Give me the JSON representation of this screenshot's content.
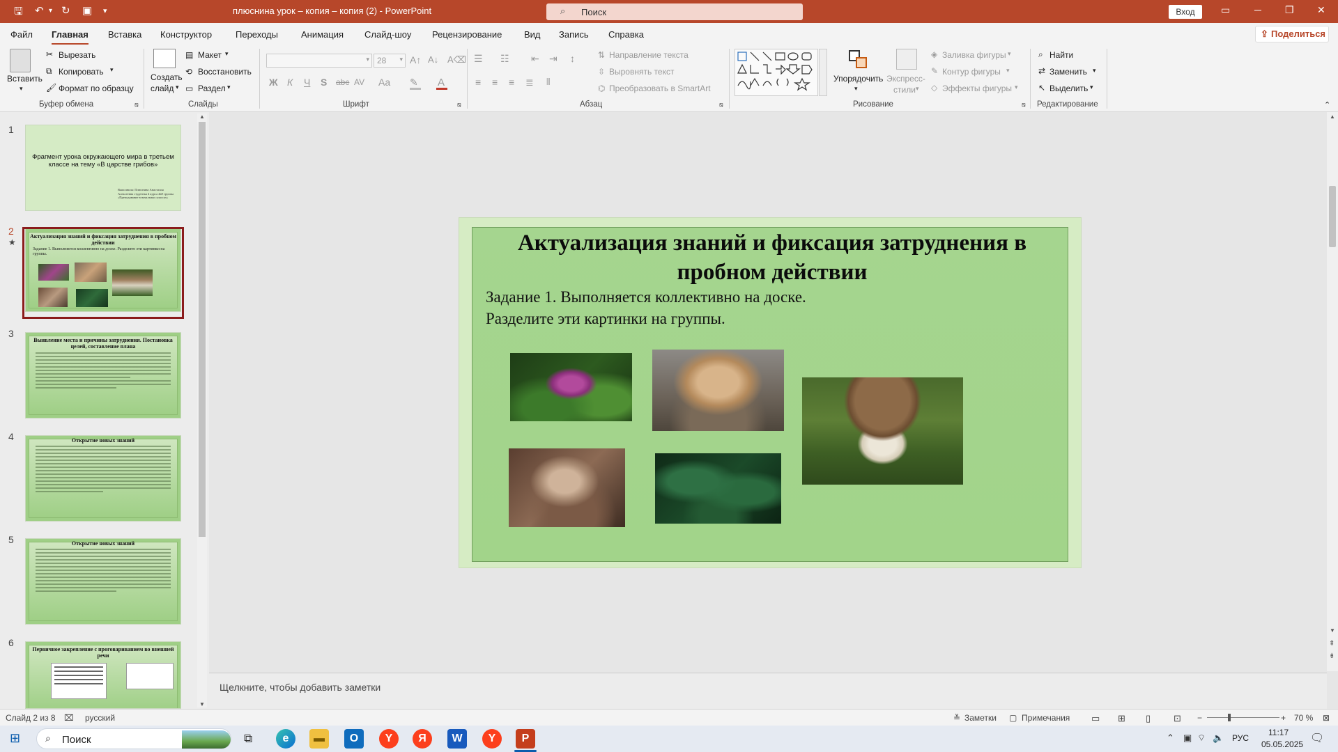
{
  "window": {
    "title": "плюснина урок – копия – копия (2)  -  PowerPoint",
    "search_placeholder": "Поиск",
    "sign_in": "Вход"
  },
  "menu": {
    "tabs": [
      "Файл",
      "Главная",
      "Вставка",
      "Конструктор",
      "Переходы",
      "Анимация",
      "Слайд-шоу",
      "Рецензирование",
      "Вид",
      "Запись",
      "Справка"
    ],
    "active": "Главная",
    "share": "Поделиться"
  },
  "ribbon": {
    "clipboard": {
      "paste": "Вставить",
      "cut": "Вырезать",
      "copy": "Копировать",
      "format_painter": "Формат по образцу",
      "title": "Буфер обмена"
    },
    "slides": {
      "new_slide_1": "Создать",
      "new_slide_2": "слайд",
      "layout": "Макет",
      "reset": "Восстановить",
      "section": "Раздел",
      "title": "Слайды"
    },
    "font": {
      "size": "28",
      "title": "Шрифт",
      "bold": "Ж",
      "italic": "К",
      "underline": "Ч",
      "shadow": "S",
      "strike": "abc",
      "spacing": "AV",
      "case": "Aa"
    },
    "paragraph": {
      "text_direction": "Направление текста",
      "align_text": "Выровнять текст",
      "smartart": "Преобразовать в SmartArt",
      "title": "Абзац"
    },
    "drawing": {
      "arrange": "Упорядочить",
      "quick_styles_1": "Экспресс-",
      "quick_styles_2": "стили",
      "shape_fill": "Заливка фигуры",
      "shape_outline": "Контур фигуры",
      "shape_effects": "Эффекты фигуры",
      "title": "Рисование"
    },
    "editing": {
      "find": "Найти",
      "replace": "Заменить",
      "select": "Выделить",
      "title": "Редактирование"
    }
  },
  "thumbnails": [
    {
      "num": "1",
      "title": "Фрагмент урока окружающего мира в третьем классе на тему «В царстве грибов»",
      "sub": "Выполнила: Плюснина Анастасия Алексеевна студентка 4 курса 4в9 группы «Преподавание в начальных классах»"
    },
    {
      "num": "2",
      "title": "Актуализация знаний и фиксация затруднения в пробном действии",
      "sub": "Задание 1. Выполняется коллективно на доске. Разделите эти картинки на группы."
    },
    {
      "num": "3",
      "title": "Выявление места и причины затруднения. Постановка целей, составление плана"
    },
    {
      "num": "4",
      "title": "Открытие новых знаний"
    },
    {
      "num": "5",
      "title": "Открытие новых знаний"
    },
    {
      "num": "6",
      "title": "Первичное закрепление с проговариванием во внешней речи"
    }
  ],
  "slide": {
    "title": "Актуализация знаний  и фиксация затруднения в пробном действии",
    "line1": "Задание 1. Выполняется коллективно на доске.",
    "line2": "Разделите эти картинки на группы."
  },
  "notes_placeholder": "Щелкните, чтобы добавить заметки",
  "status": {
    "slide_of": "Слайд 2 из 8",
    "language": "русский",
    "notes": "Заметки",
    "comments": "Примечания",
    "zoom": "70 %"
  },
  "taskbar": {
    "search": "Поиск",
    "lang": "РУС",
    "time": "11:17",
    "date": "05.05.2025"
  },
  "colors": {
    "accent": "#b7472a",
    "slide_green": "#a5d58f"
  }
}
